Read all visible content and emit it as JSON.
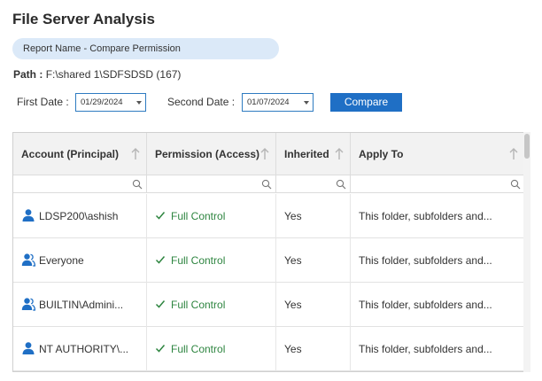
{
  "page": {
    "title": "File Server Analysis"
  },
  "report": {
    "name_label": "Report Name - Compare Permission"
  },
  "path": {
    "label": "Path :",
    "value": "F:\\shared 1\\SDFSDSD (167)"
  },
  "dates": {
    "first_label": "First Date :",
    "first_value": "01/29/2024",
    "second_label": "Second Date :",
    "second_value": "01/07/2024"
  },
  "compare_button": {
    "label": "Compare"
  },
  "colors": {
    "accent": "#1f6fc5",
    "success": "#2e8540",
    "pill": "#dbe9f8"
  },
  "table": {
    "columns": [
      {
        "label": "Account (Principal)"
      },
      {
        "label": "Permission (Access)"
      },
      {
        "label": "Inherited"
      },
      {
        "label": "Apply To"
      }
    ],
    "rows": [
      {
        "account": "LDSP200\\ashish",
        "account_icon": "user-icon",
        "permission": "Full Control",
        "inherited": "Yes",
        "apply_to": "This folder, subfolders and..."
      },
      {
        "account": "Everyone",
        "account_icon": "group-icon",
        "permission": "Full Control",
        "inherited": "Yes",
        "apply_to": "This folder, subfolders and..."
      },
      {
        "account": "BUILTIN\\Admini...",
        "account_icon": "group-icon",
        "permission": "Full Control",
        "inherited": "Yes",
        "apply_to": "This folder, subfolders and..."
      },
      {
        "account": "NT AUTHORITY\\...",
        "account_icon": "user-icon",
        "permission": "Full Control",
        "inherited": "Yes",
        "apply_to": "This folder, subfolders and..."
      }
    ]
  }
}
